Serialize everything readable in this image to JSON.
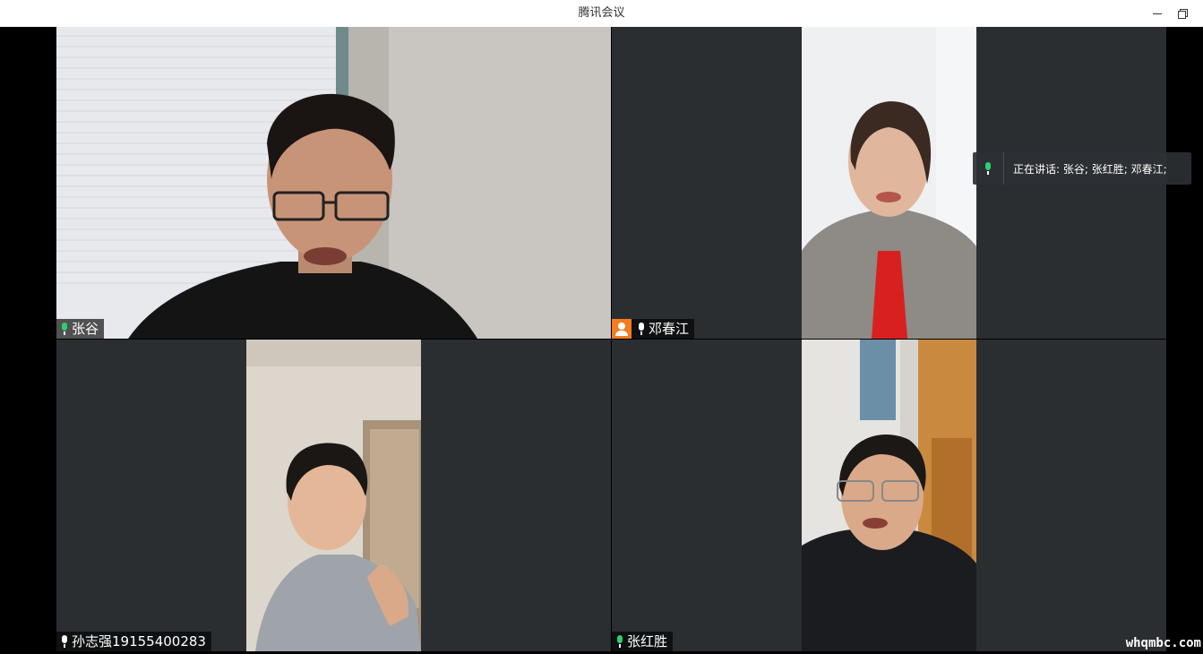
{
  "window": {
    "title": "腾讯会议"
  },
  "speaking_indicator": {
    "text": "正在讲话: 张谷; 张红胜; 邓春江;"
  },
  "participants": [
    {
      "name": "张谷",
      "mic": "active",
      "highlighted": true
    },
    {
      "name": "邓春江",
      "mic": "on",
      "host": true
    },
    {
      "name": "孙志强19155400283",
      "mic": "on"
    },
    {
      "name": "张红胜",
      "mic": "active"
    }
  ],
  "watermark": "whqmbc.com",
  "colors": {
    "accent": "#2bd06d",
    "host_badge": "#f57c1f",
    "tile_bg": "#2b2e31"
  }
}
